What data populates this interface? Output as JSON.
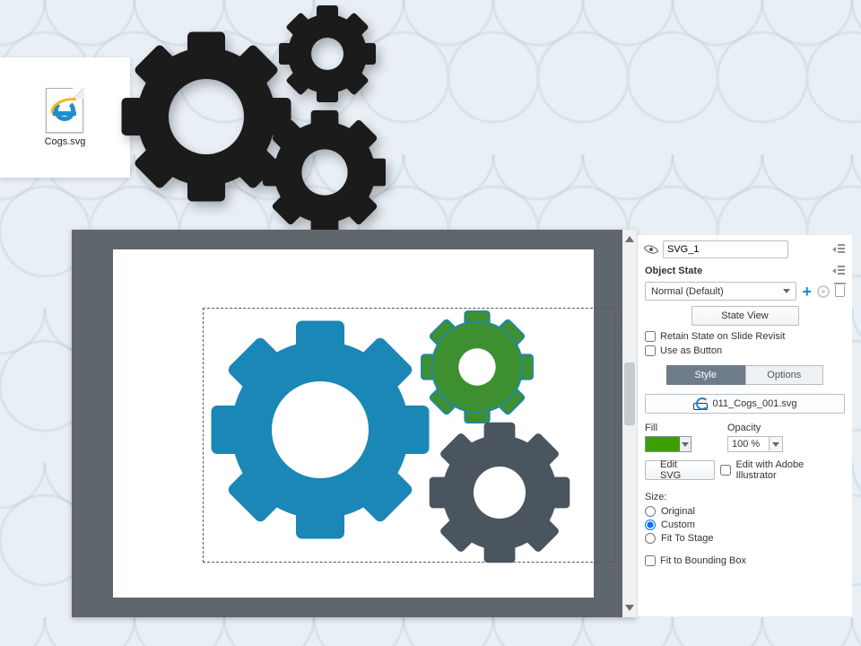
{
  "desktop_file": {
    "name": "Cogs.svg"
  },
  "panel": {
    "object_name": "SVG_1",
    "section_state_title": "Object State",
    "state_dropdown": "Normal (Default)",
    "state_view_btn": "State View",
    "retain_state": "Retain State on Slide Revisit",
    "use_as_button": "Use as Button",
    "tab_style": "Style",
    "tab_options": "Options",
    "svg_filename": "011_Cogs_001.svg",
    "fill_label": "Fill",
    "opacity_label": "Opacity",
    "opacity_value": "100 %",
    "edit_svg_btn": "Edit SVG",
    "edit_illustrator": "Edit with Adobe Illustrator",
    "size_label": "Size:",
    "size_original": "Original",
    "size_custom": "Custom",
    "size_fit": "Fit To Stage",
    "fit_bbox": "Fit to Bounding Box"
  }
}
